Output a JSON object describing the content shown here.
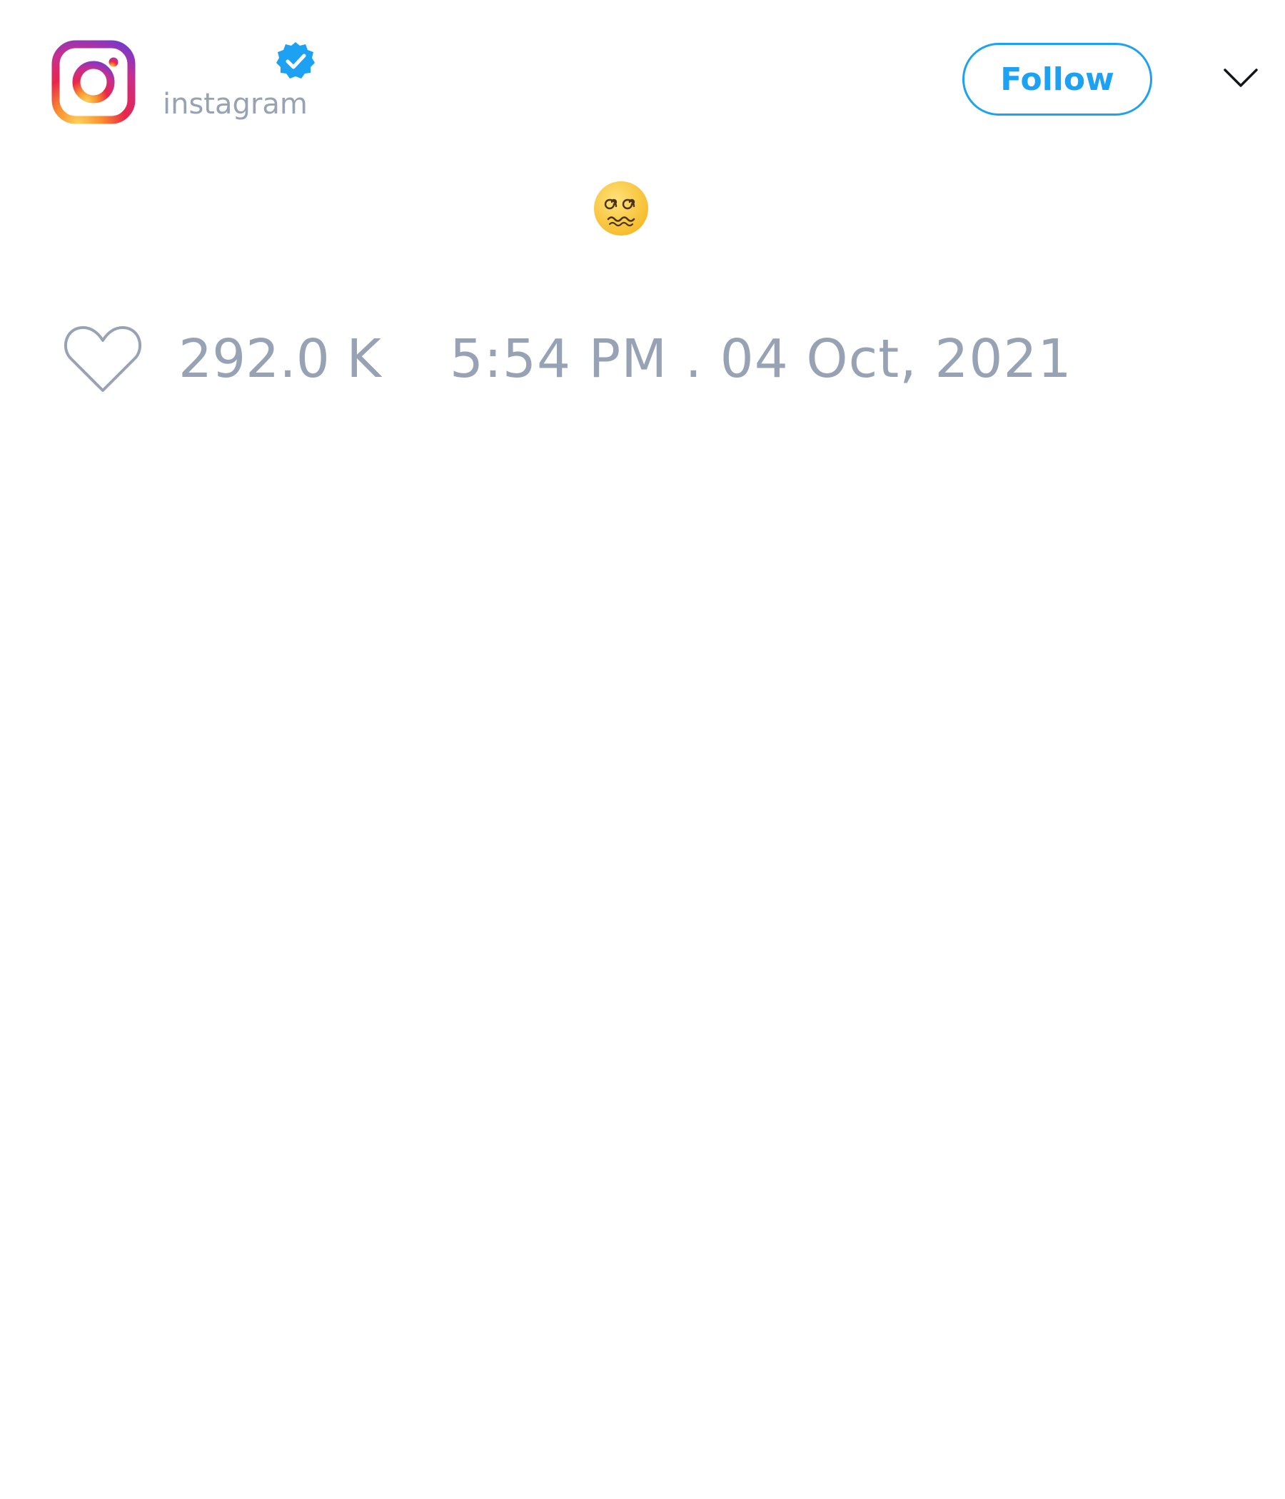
{
  "account": {
    "display_name": "",
    "handle": "instagram",
    "verified": true,
    "avatar_icon": "instagram-logo-icon"
  },
  "actions": {
    "follow_label": "Follow",
    "menu_icon": "chevron-down-icon"
  },
  "tweet": {
    "content_emoji": "face-with-spiral-eyes"
  },
  "stats": {
    "likes": "292.0 K",
    "like_icon": "heart-icon",
    "timestamp": "5:54 PM . 04 Oct, 2021"
  },
  "colors": {
    "accent": "#1da1f2",
    "muted_text": "#97a3b4",
    "background": "#ffffff"
  }
}
